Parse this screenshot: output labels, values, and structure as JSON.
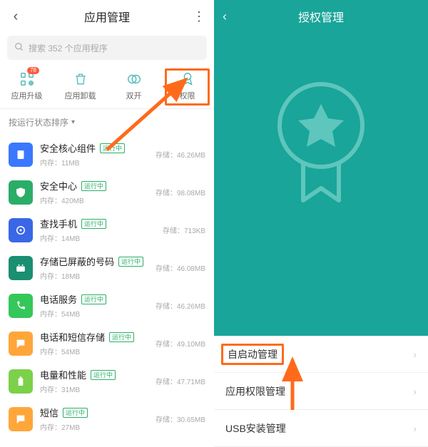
{
  "left": {
    "title": "应用管理",
    "search_placeholder": "搜索 352 个应用程序",
    "tabs": [
      {
        "label": "应用升级",
        "badge": "78"
      },
      {
        "label": "应用卸载"
      },
      {
        "label": "双开"
      },
      {
        "label": "权限"
      }
    ],
    "sort_label": "按运行状态排序",
    "storage_prefix": "存储：",
    "mem_prefix": "内存：",
    "running_tag": "运行中",
    "apps": [
      {
        "name": "安全核心组件",
        "mem": "11MB",
        "storage": "46.26MB",
        "icon_bg": "#3a78ff",
        "icon_fg": "#ffffff",
        "glyph": "file"
      },
      {
        "name": "安全中心",
        "mem": "420MB",
        "storage": "98.08MB",
        "icon_bg": "#2aae67",
        "icon_fg": "#ffffff",
        "glyph": "shield"
      },
      {
        "name": "查找手机",
        "mem": "14MB",
        "storage": "713KB",
        "icon_bg": "#3a67e6",
        "icon_fg": "#ffffff",
        "glyph": "target"
      },
      {
        "name": "存储已屏蔽的号码",
        "mem": "18MB",
        "storage": "46.08MB",
        "icon_bg": "#1a8f71",
        "icon_fg": "#ffffff",
        "glyph": "android"
      },
      {
        "name": "电话服务",
        "mem": "54MB",
        "storage": "46.26MB",
        "icon_bg": "#34c759",
        "icon_fg": "#ffffff",
        "glyph": "phone"
      },
      {
        "name": "电话和短信存储",
        "mem": "54MB",
        "storage": "49.10MB",
        "icon_bg": "#ffa63a",
        "icon_fg": "#ffffff",
        "glyph": "chat"
      },
      {
        "name": "电量和性能",
        "mem": "31MB",
        "storage": "47.71MB",
        "icon_bg": "#7bd149",
        "icon_fg": "#ffffff",
        "glyph": "battery"
      },
      {
        "name": "短信",
        "mem": "27MB",
        "storage": "30.65MB",
        "icon_bg": "#ffa63a",
        "icon_fg": "#ffffff",
        "glyph": "chat"
      }
    ]
  },
  "right": {
    "title": "授权管理",
    "rows": [
      {
        "label": "自启动管理",
        "highlight": true
      },
      {
        "label": "应用权限管理"
      },
      {
        "label": "USB安装管理"
      }
    ]
  },
  "colors": {
    "teal": "#19a599",
    "highlight": "#ff6a1a"
  }
}
